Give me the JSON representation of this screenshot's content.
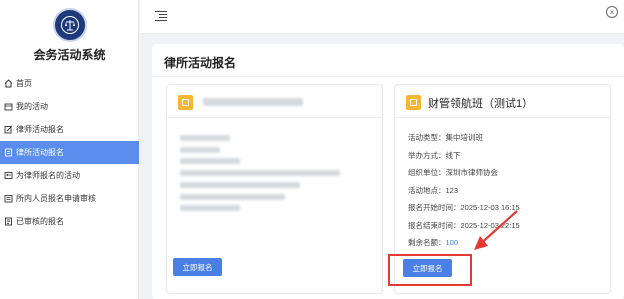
{
  "app": {
    "title": "会务活动系统"
  },
  "sidebar": {
    "items": [
      {
        "label": "首页",
        "icon": "home-icon"
      },
      {
        "label": "我的活动",
        "icon": "calendar-icon"
      },
      {
        "label": "律师活动报名",
        "icon": "edit-icon"
      },
      {
        "label": "律所活动报名",
        "icon": "document-icon",
        "active": true
      },
      {
        "label": "为律师报名的活动",
        "icon": "user-edit-icon"
      },
      {
        "label": "所内人员报名申请审核",
        "icon": "users-icon"
      },
      {
        "label": "已审核的报名",
        "icon": "checklist-icon"
      }
    ]
  },
  "main": {
    "title": "律所活动报名",
    "cards": [
      {
        "title": "",
        "button_label": "立即报名"
      },
      {
        "title": "财管领航班（测试1）",
        "fields": [
          {
            "label": "活动类型：",
            "value": "集中培训班"
          },
          {
            "label": "举办方式：",
            "value": "线下"
          },
          {
            "label": "组织单位：",
            "value": "深圳市律师协会"
          },
          {
            "label": "活动地点：",
            "value": "123"
          },
          {
            "label": "报名开始时间：",
            "value": "2025-12-03 16:15"
          },
          {
            "label": "报名结束时间：",
            "value": "2025-12-03 22:15"
          },
          {
            "label": "剩余名额：",
            "value": "100"
          }
        ],
        "button_label": "立即报名"
      }
    ]
  },
  "colors": {
    "accent": "#4a7fe6",
    "sidebar_active": "#5b8def",
    "highlight": "#e53935",
    "badge": "#f7b733"
  }
}
